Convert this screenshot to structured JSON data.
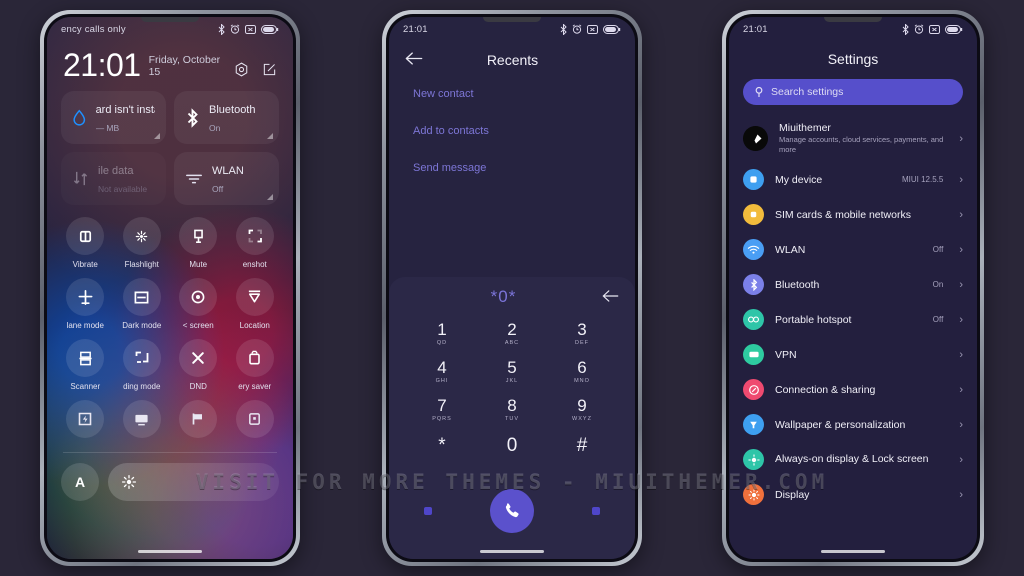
{
  "watermark": "VISIT FOR MORE THEMES - MIUITHEMER.COM",
  "colors": {
    "page_bg": "#2a2638",
    "accent_purple": "#564fcb",
    "link_purple": "#7d76d6",
    "screen_bg": "#262340"
  },
  "phone1": {
    "statusbar": {
      "left_text": "ency calls only",
      "icons": [
        "bluetooth-icon",
        "alarm-icon",
        "silent-icon",
        "battery-icon"
      ]
    },
    "clock": {
      "time": "21:01",
      "date": "Friday, October 15"
    },
    "header_icons": [
      "settings-gear-icon",
      "edit-icon"
    ],
    "big_tiles": [
      {
        "icon": "data-drop-icon",
        "title": "ard isn't install",
        "sub": "— MB",
        "dim": false
      },
      {
        "icon": "bluetooth-icon",
        "title": "Bluetooth",
        "sub": "On",
        "dim": false
      },
      {
        "icon": "mobile-data-icon",
        "title": "ile data",
        "sub": "Not available",
        "dim": true
      },
      {
        "icon": "wlan-icon",
        "title": "WLAN",
        "sub": "Off",
        "dim": false
      }
    ],
    "tiles": [
      {
        "label": "Vibrate",
        "icon": "vibrate-icon"
      },
      {
        "label": "Flashlight",
        "icon": "flashlight-icon"
      },
      {
        "label": "Mute",
        "icon": "mute-icon"
      },
      {
        "label": "enshot",
        "icon": "screenshot-icon"
      },
      {
        "label": "lane mode",
        "icon": "airplane-icon"
      },
      {
        "label": "Dark mode",
        "icon": "dark-mode-icon"
      },
      {
        "label": "< screen",
        "icon": "split-screen-icon"
      },
      {
        "label": "Location",
        "icon": "location-icon"
      },
      {
        "label": "Scanner",
        "icon": "scanner-icon"
      },
      {
        "label": "ding mode",
        "icon": "reading-mode-icon"
      },
      {
        "label": "DND",
        "icon": "dnd-icon"
      },
      {
        "label": "ery saver",
        "icon": "battery-saver-icon"
      },
      {
        "label": "",
        "icon": "power-icon"
      },
      {
        "label": "",
        "icon": "cast-icon"
      },
      {
        "label": "",
        "icon": "flag-icon"
      },
      {
        "label": "",
        "icon": "sync-icon"
      }
    ],
    "brightness": {
      "auto_label": "A",
      "slider_icon": "brightness-icon"
    }
  },
  "phone2": {
    "statusbar": {
      "left_text": "21:01",
      "icons": [
        "bluetooth-icon",
        "alarm-icon",
        "silent-icon",
        "battery-icon"
      ]
    },
    "title": "Recents",
    "back_icon": "arrow-left-icon",
    "menu": [
      "New contact",
      "Add to contacts",
      "Send message"
    ],
    "dialer": {
      "number": "*0*",
      "backspace_icon": "backspace-arrow-icon",
      "keys": [
        {
          "digit": "1",
          "letters": "QD"
        },
        {
          "digit": "2",
          "letters": "ABC"
        },
        {
          "digit": "3",
          "letters": "DEF"
        },
        {
          "digit": "4",
          "letters": "GHI"
        },
        {
          "digit": "5",
          "letters": "JKL"
        },
        {
          "digit": "6",
          "letters": "MNO"
        },
        {
          "digit": "7",
          "letters": "PQRS"
        },
        {
          "digit": "8",
          "letters": "TUV"
        },
        {
          "digit": "9",
          "letters": "WXYZ"
        },
        {
          "digit": "*",
          "letters": ""
        },
        {
          "digit": "0",
          "letters": ""
        },
        {
          "digit": "#",
          "letters": ""
        }
      ],
      "call_icon": "phone-call-icon"
    }
  },
  "phone3": {
    "statusbar": {
      "left_text": "21:01",
      "icons": [
        "bluetooth-icon",
        "alarm-icon",
        "silent-icon",
        "battery-icon"
      ]
    },
    "title": "Settings",
    "search": {
      "placeholder": "Search settings",
      "icon": "search-pin-icon"
    },
    "account": {
      "name": "Miuithemer",
      "desc": "Manage accounts, cloud services, payments, and more",
      "icon": "avatar-icon"
    },
    "rows": [
      {
        "name": "My device",
        "value": "MIUI 12.5.5",
        "icon": "device-icon",
        "color": "#3e9ff0"
      },
      {
        "name": "SIM cards & mobile networks",
        "value": "",
        "icon": "sim-icon",
        "color": "#f2bb3c"
      },
      {
        "name": "WLAN",
        "value": "Off",
        "icon": "wifi-icon",
        "color": "#4a9ef4"
      },
      {
        "name": "Bluetooth",
        "value": "On",
        "icon": "bluetooth-icon",
        "color": "#7b80e8"
      },
      {
        "name": "Portable hotspot",
        "value": "Off",
        "icon": "hotspot-icon",
        "color": "#2ec5a8"
      },
      {
        "name": "VPN",
        "value": "",
        "icon": "vpn-icon",
        "color": "#2ecba0"
      },
      {
        "name": "Connection & sharing",
        "value": "",
        "icon": "sharing-icon",
        "color": "#ef4a70"
      },
      {
        "name": "Wallpaper & personalization",
        "value": "",
        "icon": "wallpaper-icon",
        "color": "#3e9ff0"
      },
      {
        "name": "Always-on display & Lock screen",
        "value": "",
        "icon": "aod-icon",
        "color": "#2ec5a8"
      },
      {
        "name": "Display",
        "value": "",
        "icon": "display-icon",
        "color": "#f0703c"
      }
    ]
  }
}
